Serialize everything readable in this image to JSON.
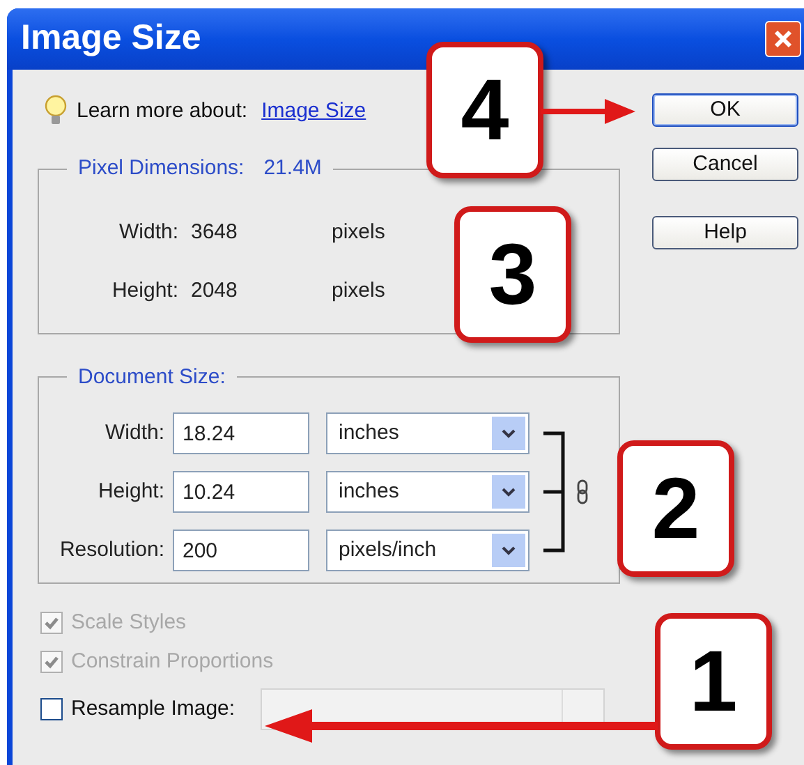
{
  "window": {
    "title": "Image Size"
  },
  "learn_more": {
    "prefix": "Learn more about:",
    "link": "Image Size"
  },
  "buttons": [
    {
      "label": "OK",
      "default": true
    },
    {
      "label": "Cancel",
      "default": false
    },
    {
      "label": "Help",
      "default": false
    }
  ],
  "pixel_dimensions": {
    "title": "Pixel Dimensions:",
    "total": "21.4M",
    "rows": [
      {
        "label": "Width:",
        "value": "3648",
        "unit": "pixels"
      },
      {
        "label": "Height:",
        "value": "2048",
        "unit": "pixels"
      }
    ]
  },
  "document_size": {
    "title": "Document Size:",
    "constrained": true,
    "rows": [
      {
        "label": "Width:",
        "value": "18.24",
        "unit": "inches"
      },
      {
        "label": "Height:",
        "value": "10.24",
        "unit": "inches"
      },
      {
        "label": "Resolution:",
        "value": "200",
        "unit": "pixels/inch"
      }
    ]
  },
  "options": [
    {
      "label": "Scale Styles",
      "checked": true,
      "disabled": true
    },
    {
      "label": "Constrain Proportions",
      "checked": true,
      "disabled": true
    },
    {
      "label": "Resample Image:",
      "checked": false,
      "disabled": false
    }
  ],
  "resample_method": {
    "disabled": true
  },
  "callouts": [
    {
      "number": "4",
      "arrow": true
    },
    {
      "number": "3",
      "arrow": false
    },
    {
      "number": "2",
      "arrow": false
    },
    {
      "number": "1",
      "arrow": true
    }
  ]
}
